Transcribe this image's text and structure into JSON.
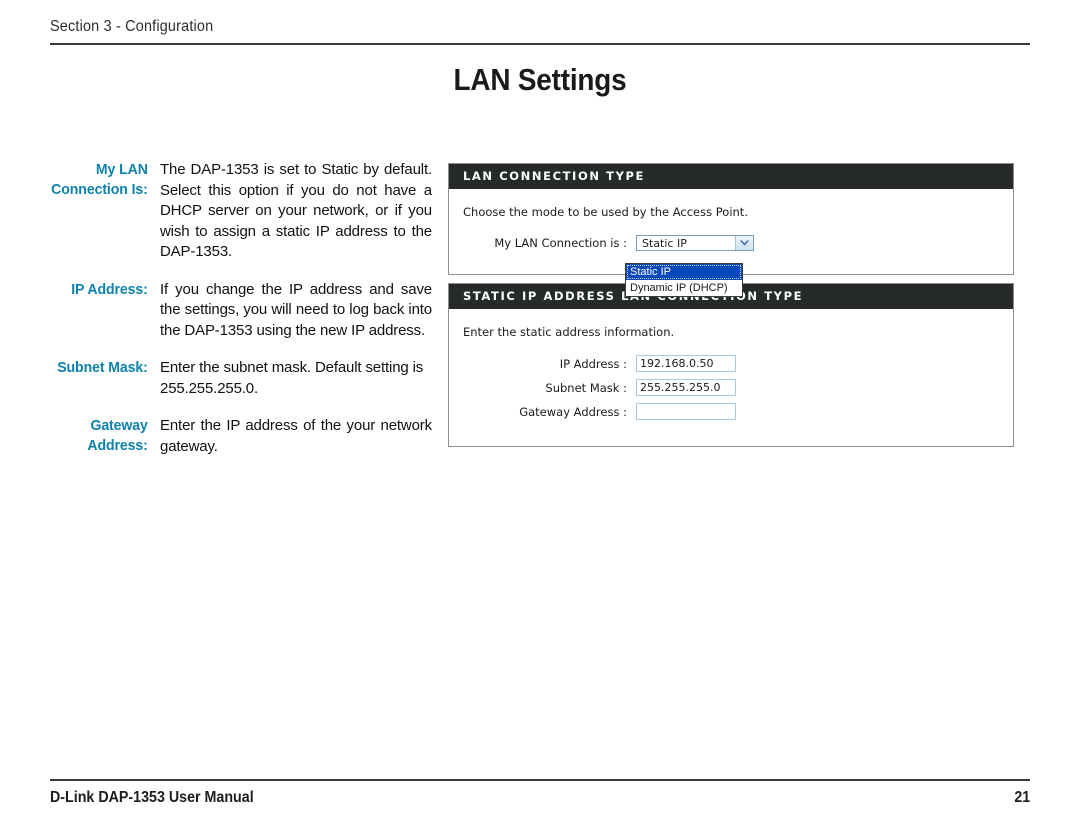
{
  "header": {
    "section_label": "Section 3 - Configuration"
  },
  "title": "LAN Settings",
  "definitions": [
    {
      "term": "My LAN Connection Is:",
      "description": "The DAP-1353 is set to Static by default. Select this option if you do not have a DHCP server on your network, or if you wish to assign a static IP address to the DAP-1353."
    },
    {
      "term": "IP Address:",
      "description": "If you change the IP address and save the settings, you will need to log back into the DAP-1353 using the new IP address."
    },
    {
      "term": "Subnet Mask:",
      "description": "Enter the subnet mask. Default setting is 255.255.255.0."
    },
    {
      "term": "Gateway Address:",
      "description": "Enter the IP address of the your network gateway."
    }
  ],
  "screenshot": {
    "lan_connection_panel": {
      "heading": "LAN CONNECTION TYPE",
      "intro": "Choose the mode to be used by the Access Point.",
      "field_label": "My LAN Connection is :",
      "selected_value": "Static IP",
      "options": [
        {
          "label": "Static IP",
          "selected": true
        },
        {
          "label": "Dynamic IP (DHCP)",
          "selected": false
        }
      ]
    },
    "static_ip_panel": {
      "heading": "STATIC IP ADDRESS LAN CONNECTION TYPE",
      "intro": "Enter the static address information.",
      "fields": [
        {
          "label": "IP Address :",
          "value": "192.168.0.50",
          "placeholder": ""
        },
        {
          "label": "Subnet Mask :",
          "value": "255.255.255.0",
          "placeholder": ""
        },
        {
          "label": "Gateway Address :",
          "value": "",
          "placeholder": ""
        }
      ]
    }
  },
  "footer": {
    "manual_name": "D-Link DAP-1353 User Manual",
    "page_number": "21"
  },
  "colors": {
    "term_blue": "#0e82ad",
    "panel_header_dark": "#262a2a",
    "option_highlight": "#0a48bc",
    "input_border": "#a9c8de"
  }
}
